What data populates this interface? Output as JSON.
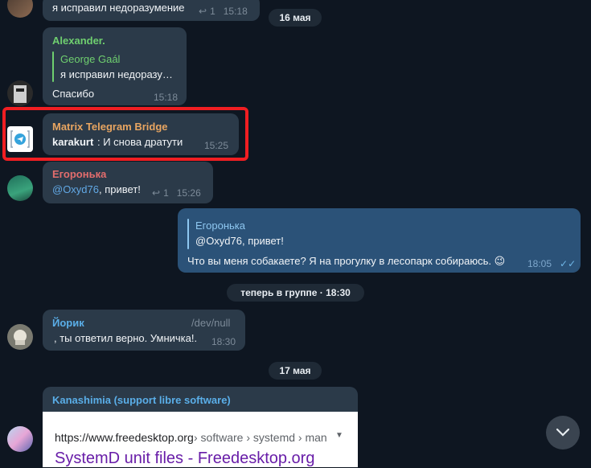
{
  "colors": {
    "background": "#0e1621",
    "incoming_bubble": "#2b3a49",
    "outgoing_bubble": "#2b5278",
    "highlight": "#f01e22",
    "name_green": "#6fcf6f",
    "name_orange": "#e8a561",
    "name_red": "#e36d6d",
    "name_blue": "#5aaee8",
    "mention_blue": "#62a9e6"
  },
  "messages": [
    {
      "id": "m0",
      "text": "я исправил недоразумение",
      "reply_count": "1",
      "time": "15:18"
    },
    {
      "id": "m1",
      "sender": "Alexander.",
      "quote_author": "George Gaál",
      "quote_text": "я исправил недоразу…",
      "text": "Спасибо",
      "time": "15:18"
    },
    {
      "id": "m2",
      "sender": "Matrix Telegram Bridge",
      "bold_prefix": "karakurt",
      "text": ": И снова дратути",
      "time": "15:25"
    },
    {
      "id": "m3",
      "sender": "Егоронька",
      "mention": "@Oxyd76",
      "text": ", привет!",
      "reply_count": "1",
      "time": "15:26"
    },
    {
      "id": "m4",
      "quote_author": "Егоронька",
      "quote_text": "@Oxyd76, привет!",
      "text": "Что вы меня собакаете? Я на прогулку в лесопарк собираюсь. 😉",
      "time": "18:05"
    },
    {
      "id": "m5",
      "sender": "Йорик",
      "badge": "/dev/null",
      "text": ", ты ответил верно. Умничка!.",
      "time": "18:30"
    },
    {
      "id": "m6",
      "sender": "Kanashimia (support libre software)",
      "link_url": "https://www.freedesktop.org",
      "link_path": " › software › systemd › man",
      "link_title": "SystemD unit files - Freedesktop.org"
    }
  ],
  "dates": {
    "d1": "16 мая",
    "d2": "17 мая"
  },
  "service": {
    "joined": "теперь в группе · 18:30"
  }
}
